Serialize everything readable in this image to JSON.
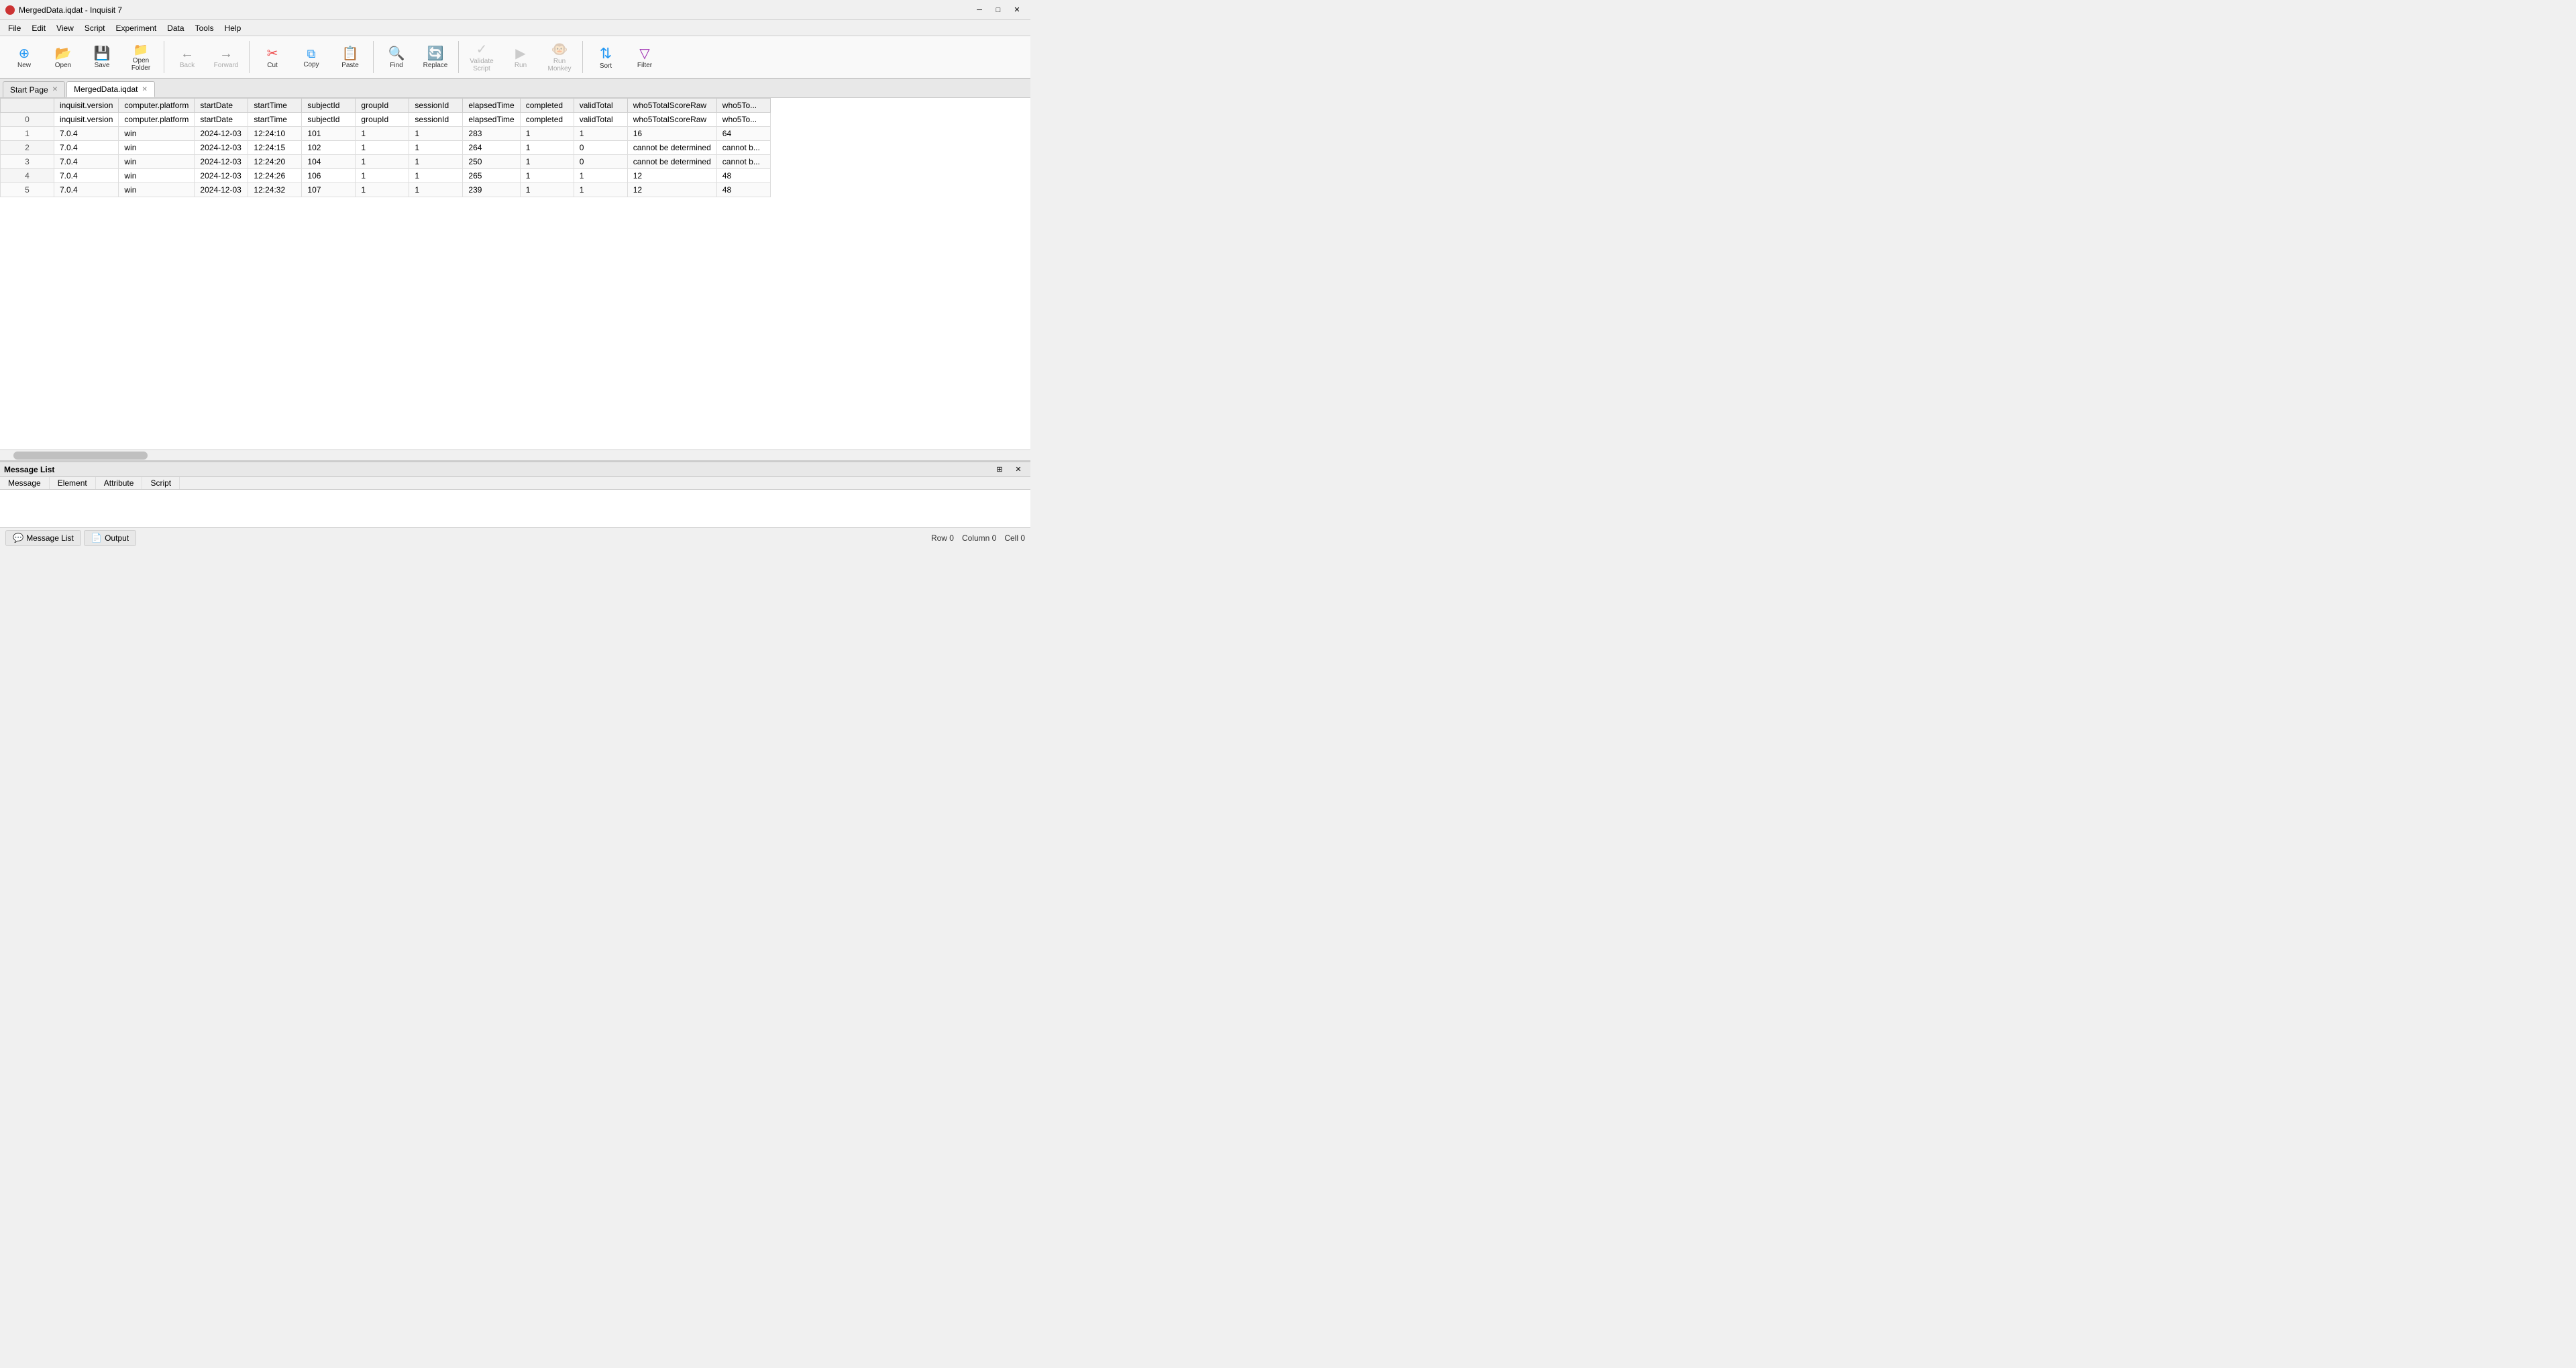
{
  "window": {
    "title": "MergedData.iqdat - Inquisit 7",
    "icon": "inquisit-icon"
  },
  "menu": {
    "items": [
      "File",
      "Edit",
      "View",
      "Script",
      "Experiment",
      "Data",
      "Tools",
      "Help"
    ]
  },
  "toolbar": {
    "buttons": [
      {
        "id": "new",
        "label": "New",
        "icon": "⊕",
        "color": "#2196F3",
        "disabled": false
      },
      {
        "id": "open",
        "label": "Open",
        "icon": "📂",
        "color": "#FF9800",
        "disabled": false
      },
      {
        "id": "save",
        "label": "Save",
        "icon": "💾",
        "color": "#FF9800",
        "disabled": false
      },
      {
        "id": "open-folder",
        "label": "Open Folder",
        "icon": "📁",
        "color": "#FF9800",
        "disabled": false
      },
      {
        "id": "sep1",
        "type": "separator"
      },
      {
        "id": "back",
        "label": "Back",
        "icon": "←",
        "color": "#555",
        "disabled": true
      },
      {
        "id": "forward",
        "label": "Forward",
        "icon": "→",
        "color": "#555",
        "disabled": true
      },
      {
        "id": "sep2",
        "type": "separator"
      },
      {
        "id": "cut",
        "label": "Cut",
        "icon": "✂",
        "color": "#e44",
        "disabled": false
      },
      {
        "id": "copy",
        "label": "Copy",
        "icon": "⧉",
        "color": "#2196F3",
        "disabled": false
      },
      {
        "id": "paste",
        "label": "Paste",
        "icon": "📋",
        "color": "#555",
        "disabled": false
      },
      {
        "id": "sep3",
        "type": "separator"
      },
      {
        "id": "find",
        "label": "Find",
        "icon": "🔍",
        "color": "#FF9800",
        "disabled": false
      },
      {
        "id": "replace",
        "label": "Replace",
        "icon": "🔄",
        "color": "#2196F3",
        "disabled": false
      },
      {
        "id": "sep4",
        "type": "separator"
      },
      {
        "id": "validate",
        "label": "Validate Script",
        "icon": "✓",
        "color": "#888",
        "disabled": true
      },
      {
        "id": "run",
        "label": "Run",
        "icon": "▶",
        "color": "#888",
        "disabled": true
      },
      {
        "id": "run-monkey",
        "label": "Run Monkey",
        "icon": "🐵",
        "color": "#888",
        "disabled": true
      },
      {
        "id": "sep5",
        "type": "separator"
      },
      {
        "id": "sort",
        "label": "Sort",
        "icon": "↕",
        "color": "#2196F3",
        "disabled": false
      },
      {
        "id": "filter",
        "label": "Filter",
        "icon": "▽",
        "color": "#9C27B0",
        "disabled": false
      }
    ]
  },
  "tabs": [
    {
      "id": "start-page",
      "label": "Start Page",
      "closable": true,
      "active": false
    },
    {
      "id": "merged-data",
      "label": "MergedData.iqdat",
      "closable": true,
      "active": true
    }
  ],
  "table": {
    "columns": [
      {
        "id": "row-num",
        "label": ""
      },
      {
        "id": "inquisit-version",
        "label": "inquisit.version"
      },
      {
        "id": "computer-platform",
        "label": "computer.platform"
      },
      {
        "id": "startDate",
        "label": "startDate"
      },
      {
        "id": "startTime",
        "label": "startTime"
      },
      {
        "id": "subjectId",
        "label": "subjectId"
      },
      {
        "id": "groupId",
        "label": "groupId"
      },
      {
        "id": "sessionId",
        "label": "sessionId"
      },
      {
        "id": "elapsedTime",
        "label": "elapsedTime"
      },
      {
        "id": "completed",
        "label": "completed"
      },
      {
        "id": "validTotal",
        "label": "validTotal"
      },
      {
        "id": "who5TotalScoreRaw",
        "label": "who5TotalScoreRaw"
      },
      {
        "id": "who5To",
        "label": "who5To..."
      }
    ],
    "rows": [
      {
        "num": "0",
        "cells": [
          "inquisit.version",
          "computer.platform",
          "startDate",
          "startTime",
          "subjectId",
          "groupId",
          "sessionId",
          "elapsedTime",
          "completed",
          "validTotal",
          "who5TotalScoreRaw",
          "who5To..."
        ]
      },
      {
        "num": "1",
        "cells": [
          "7.0.4",
          "win",
          "2024-12-03",
          "12:24:10",
          "101",
          "1",
          "1",
          "283",
          "1",
          "1",
          "16",
          "64"
        ]
      },
      {
        "num": "2",
        "cells": [
          "7.0.4",
          "win",
          "2024-12-03",
          "12:24:15",
          "102",
          "1",
          "1",
          "264",
          "1",
          "0",
          "cannot be determined",
          "cannot b..."
        ]
      },
      {
        "num": "3",
        "cells": [
          "7.0.4",
          "win",
          "2024-12-03",
          "12:24:20",
          "104",
          "1",
          "1",
          "250",
          "1",
          "0",
          "cannot be determined",
          "cannot b..."
        ]
      },
      {
        "num": "4",
        "cells": [
          "7.0.4",
          "win",
          "2024-12-03",
          "12:24:26",
          "106",
          "1",
          "1",
          "265",
          "1",
          "1",
          "12",
          "48"
        ]
      },
      {
        "num": "5",
        "cells": [
          "7.0.4",
          "win",
          "2024-12-03",
          "12:24:32",
          "107",
          "1",
          "1",
          "239",
          "1",
          "1",
          "12",
          "48"
        ]
      }
    ]
  },
  "message_panel": {
    "title": "Message List",
    "tabs": [
      "Message",
      "Element",
      "Attribute",
      "Script"
    ]
  },
  "bottom_tabs": [
    {
      "id": "message-list",
      "label": "Message List",
      "icon": "msg"
    },
    {
      "id": "output",
      "label": "Output",
      "icon": "out"
    }
  ],
  "status": {
    "row": "Row 0",
    "column": "Column 0",
    "cell": "Cell 0"
  }
}
